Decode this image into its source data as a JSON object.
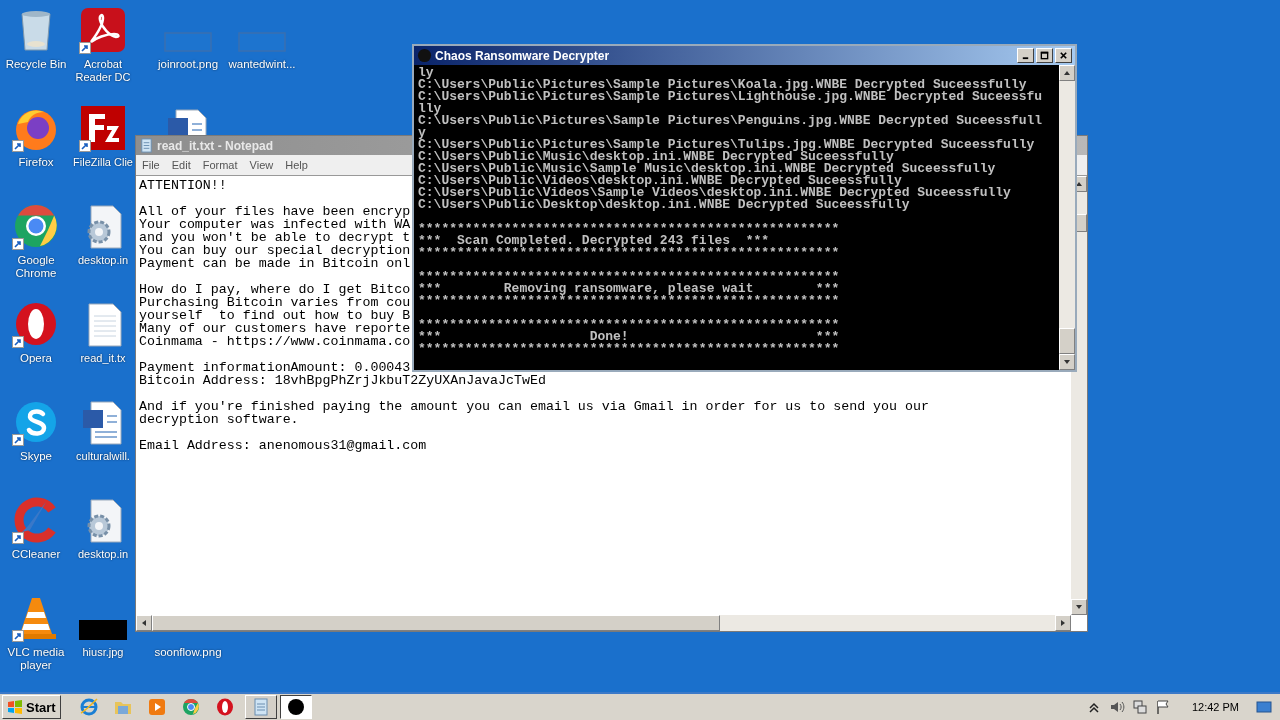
{
  "desktop": {
    "rows": [
      [
        {
          "label": "Recycle Bin",
          "kind": "recycle"
        },
        {
          "label": "Acrobat Reader DC",
          "kind": "acrobat",
          "shortcut": true
        },
        {
          "label": "joinroot.png",
          "kind": "image-blank"
        },
        {
          "label": "wantedwint...",
          "kind": "image-blank"
        }
      ],
      [
        {
          "label": "Firefox",
          "kind": "firefox",
          "shortcut": true
        },
        {
          "label": "FileZilla Clie",
          "kind": "filezilla",
          "shortcut": true
        },
        {
          "kind": "word"
        }
      ],
      [
        {
          "label": "Google Chrome",
          "kind": "chrome",
          "shortcut": true
        },
        {
          "label": "desktop.in",
          "kind": "settings-file"
        }
      ],
      [
        {
          "label": "Opera",
          "kind": "opera",
          "shortcut": true
        },
        {
          "label": "read_it.tx",
          "kind": "text-file"
        }
      ],
      [
        {
          "label": "Skype",
          "kind": "skype",
          "shortcut": true
        },
        {
          "label": "culturalwill.",
          "kind": "word"
        }
      ],
      [
        {
          "label": "CCleaner",
          "kind": "ccleaner",
          "shortcut": true
        },
        {
          "label": "desktop.in",
          "kind": "settings-file"
        }
      ],
      [
        {
          "label": "VLC media player",
          "kind": "vlc",
          "shortcut": true
        },
        {
          "label": "hiusr.jpg",
          "kind": "image-dark"
        },
        {
          "label": "soonflow.png",
          "kind": "none"
        }
      ]
    ]
  },
  "notepad": {
    "title": "read_it.txt - Notepad",
    "active": false,
    "menu": [
      "File",
      "Edit",
      "Format",
      "View",
      "Help"
    ],
    "paragraphs": [
      [
        "ATTENTION!!"
      ],
      [
        "All of your files have been encryp",
        "Your computer was infected with WA",
        "and you won't be able to decrypt t",
        "You can buy our special decryption",
        "Payment can be made in Bitcoin onl"
      ],
      [
        "How do I pay, where do I get Bitco",
        "Purchasing Bitcoin varies from cou",
        "yourself  to find out how to buy B",
        "Many of our customers have reporte",
        "Coinmama - https://www.coinmama.co"
      ],
      [
        "Payment informationAmount: 0.00043",
        "Bitcoin Address: 18vhBpgPhZrjJkbuT2ZyUXAnJavaJcTwEd"
      ],
      [
        "And if you're finished paying the amount you can email us via Gmail in order for us to send you our",
        "decryption software."
      ],
      [
        "Email Address: anenomous31@gmail.com"
      ]
    ]
  },
  "console": {
    "title": "Chaos Ransomware Decrypter",
    "active": true,
    "groups": [
      [
        "ly",
        "C:\\Users\\Public\\Pictures\\Sample Pictures\\Koala.jpg.WNBE Decrypted Suceessfully",
        "C:\\Users\\Public\\Pictures\\Sample Pictures\\Lighthouse.jpg.WNBE Decrypted Suceessfu",
        "lly",
        "C:\\Users\\Public\\Pictures\\Sample Pictures\\Penguins.jpg.WNBE Decrypted Suceessfull",
        "y",
        "C:\\Users\\Public\\Pictures\\Sample Pictures\\Tulips.jpg.WNBE Decrypted Suceessfully",
        "C:\\Users\\Public\\Music\\desktop.ini.WNBE Decrypted Suceessfully",
        "C:\\Users\\Public\\Music\\Sample Music\\desktop.ini.WNBE Decrypted Suceessfully",
        "C:\\Users\\Public\\Videos\\desktop.ini.WNBE Decrypted Suceessfully",
        "C:\\Users\\Public\\Videos\\Sample Videos\\desktop.ini.WNBE Decrypted Suceessfully",
        "C:\\Users\\Public\\Desktop\\desktop.ini.WNBE Decrypted Suceessfully"
      ],
      [
        "******************************************************",
        "***  Scan Completed. Decrypted 243 files  ***",
        "******************************************************"
      ],
      [
        "******************************************************",
        "***        Removing ransomware, please wait        ***",
        "******************************************************"
      ],
      [
        "******************************************************",
        "***                   Done!                        ***",
        "******************************************************"
      ]
    ]
  },
  "taskbar": {
    "start": "Start",
    "quick_launch": [
      {
        "kind": "ie"
      },
      {
        "kind": "folder"
      },
      {
        "kind": "media"
      },
      {
        "kind": "chrome"
      },
      {
        "kind": "opera"
      }
    ],
    "tasks": [
      {
        "kind": "notepad",
        "selected": false
      },
      {
        "kind": "chaos",
        "selected": true
      }
    ],
    "clock": "12:42 PM"
  }
}
